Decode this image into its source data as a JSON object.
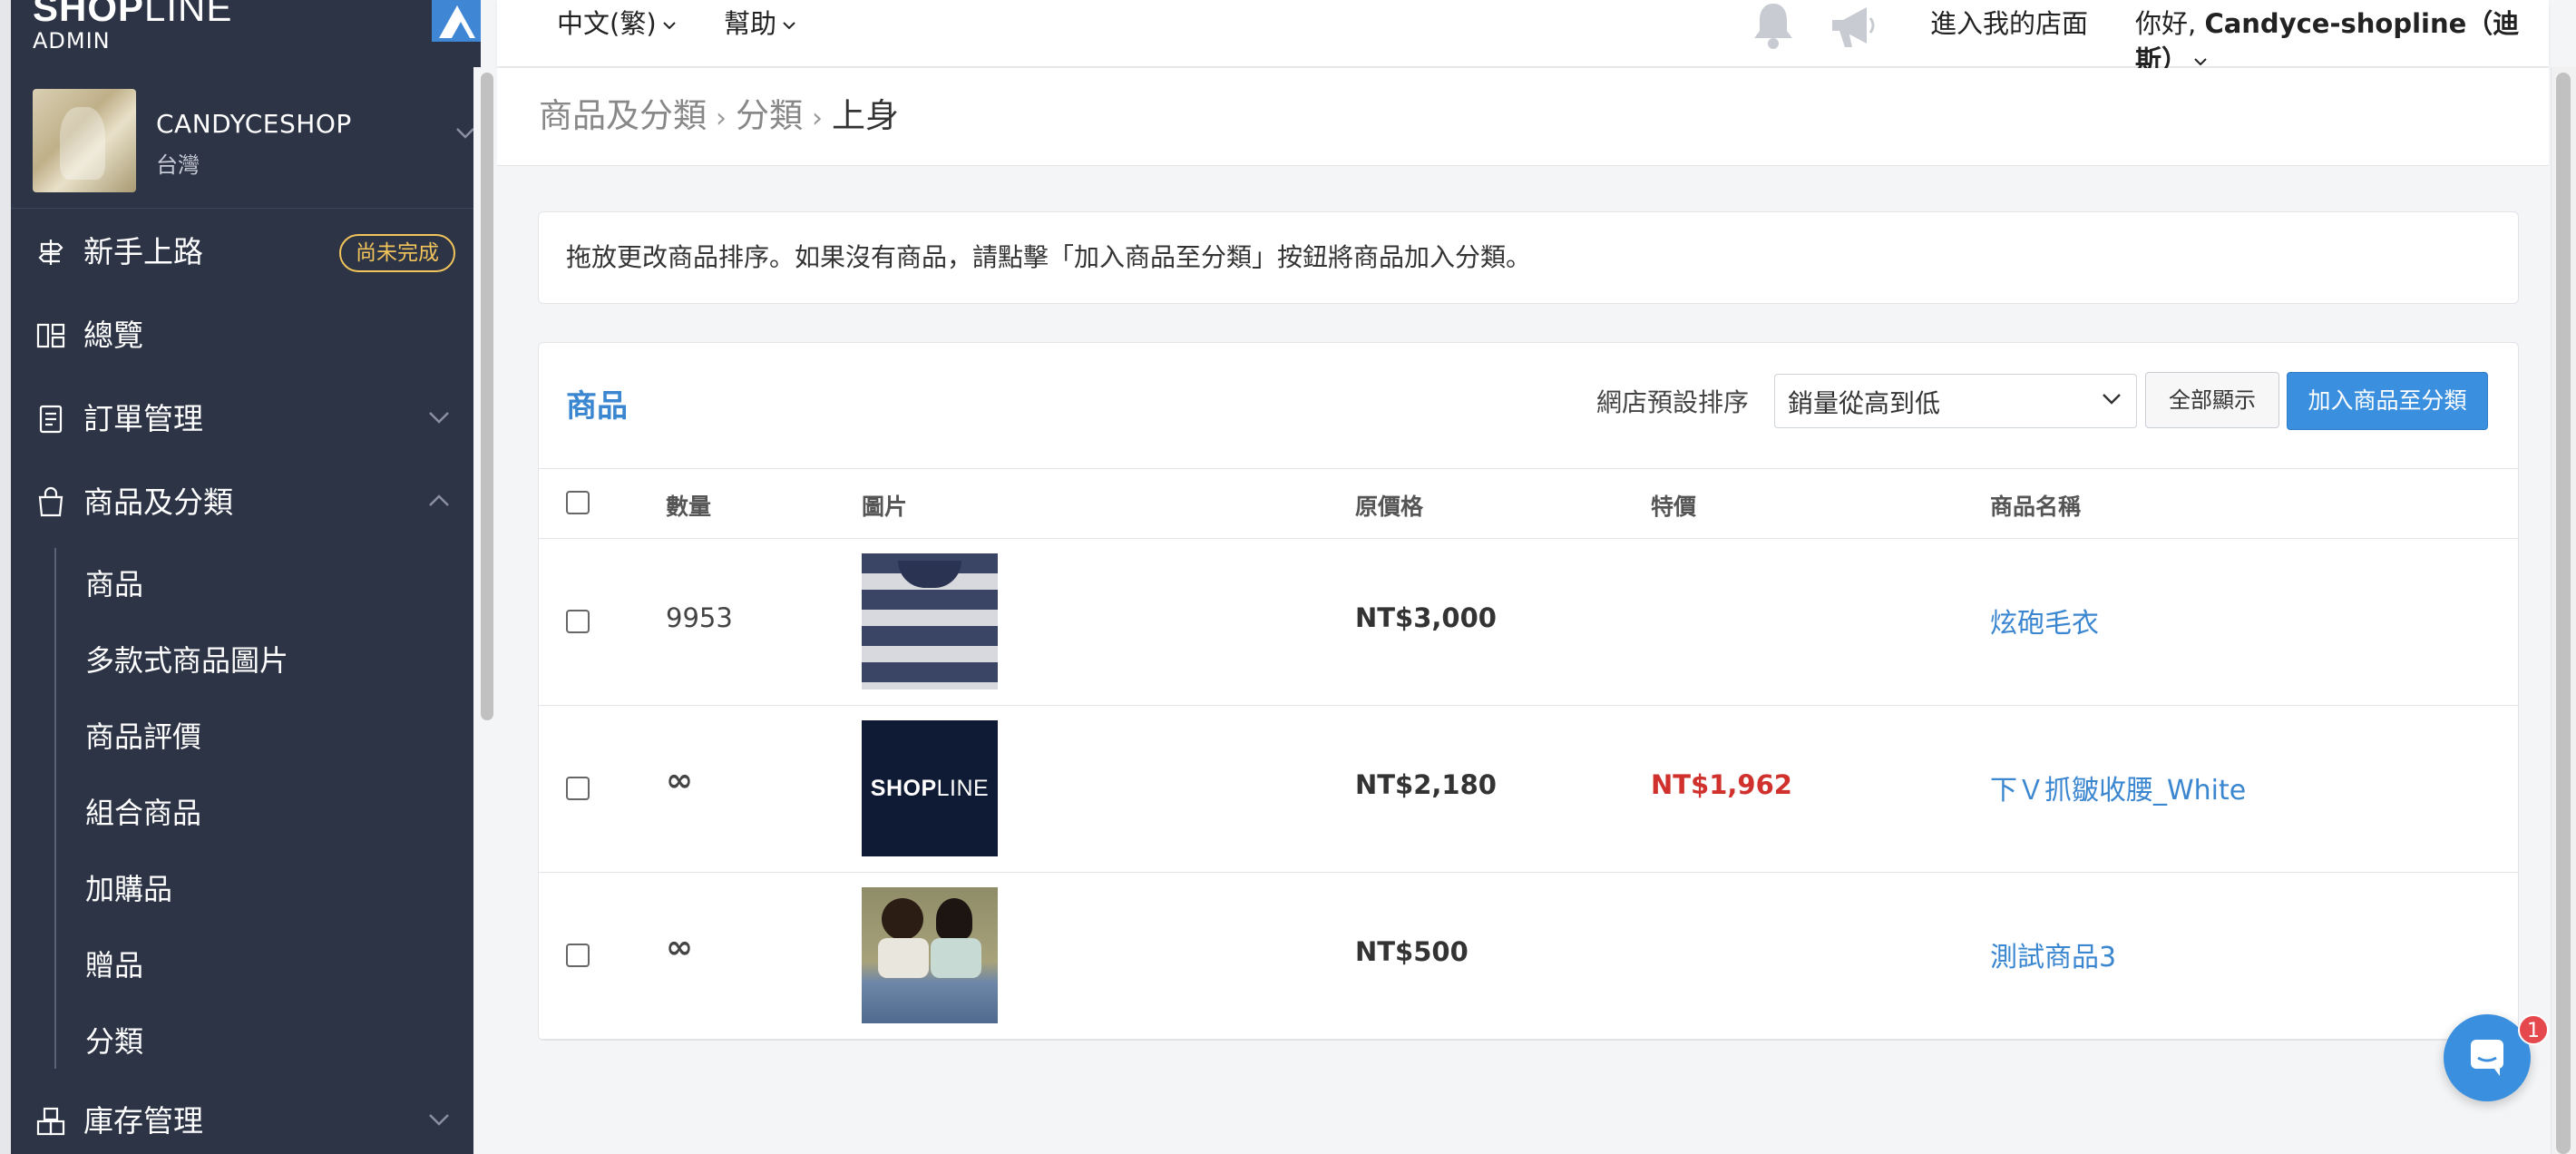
{
  "brand": {
    "logo_bold": "SHOP",
    "logo_light": "LINE",
    "sub": "ADMIN"
  },
  "shop": {
    "name": "CANDYCESHOP",
    "region": "台灣"
  },
  "nav": {
    "onboarding": {
      "label": "新手上路",
      "badge": "尚未完成"
    },
    "overview": {
      "label": "總覽"
    },
    "orders": {
      "label": "訂單管理"
    },
    "products": {
      "label": "商品及分類"
    },
    "sub_items": [
      "商品",
      "多款式商品圖片",
      "商品評價",
      "組合商品",
      "加購品",
      "贈品",
      "分類"
    ],
    "inventory": {
      "label": "庫存管理"
    }
  },
  "topbar": {
    "language": "中文(繁)",
    "help": "幫助",
    "enter_store": "進入我的店面",
    "greeting_prefix": "你好, ",
    "user_name": "Candyce-shopline（迪斯）"
  },
  "breadcrumb": {
    "items": [
      "商品及分類",
      "分類",
      "上身"
    ]
  },
  "notice": "拖放更改商品排序。如果沒有商品，請點擊「加入商品至分類」按鈕將商品加入分類。",
  "panel": {
    "title": "商品",
    "sort_label": "網店預設排序",
    "sort_value": "銷量從高到低",
    "show_all_button": "全部顯示",
    "add_button": "加入商品至分類"
  },
  "table": {
    "headers": {
      "qty": "數量",
      "image": "圖片",
      "price": "原價格",
      "sale": "特價",
      "name": "商品名稱"
    },
    "rows": [
      {
        "qty": "9953",
        "price": "NT$3,000",
        "sale": "",
        "name": "炫砲毛衣"
      },
      {
        "qty": "∞",
        "price": "NT$2,180",
        "sale": "NT$1,962",
        "name": "下Ｖ抓皺收腰_White"
      },
      {
        "qty": "∞",
        "price": "NT$500",
        "sale": "",
        "name": "測試商品3"
      }
    ],
    "thumb_logo": {
      "bold": "SHOP",
      "light": "LINE"
    }
  },
  "chat": {
    "badge": "1"
  },
  "colors": {
    "sidebar": "#2d3446",
    "accent": "#3a86d0",
    "sale": "#d0312d",
    "badge": "#f1c45b"
  }
}
